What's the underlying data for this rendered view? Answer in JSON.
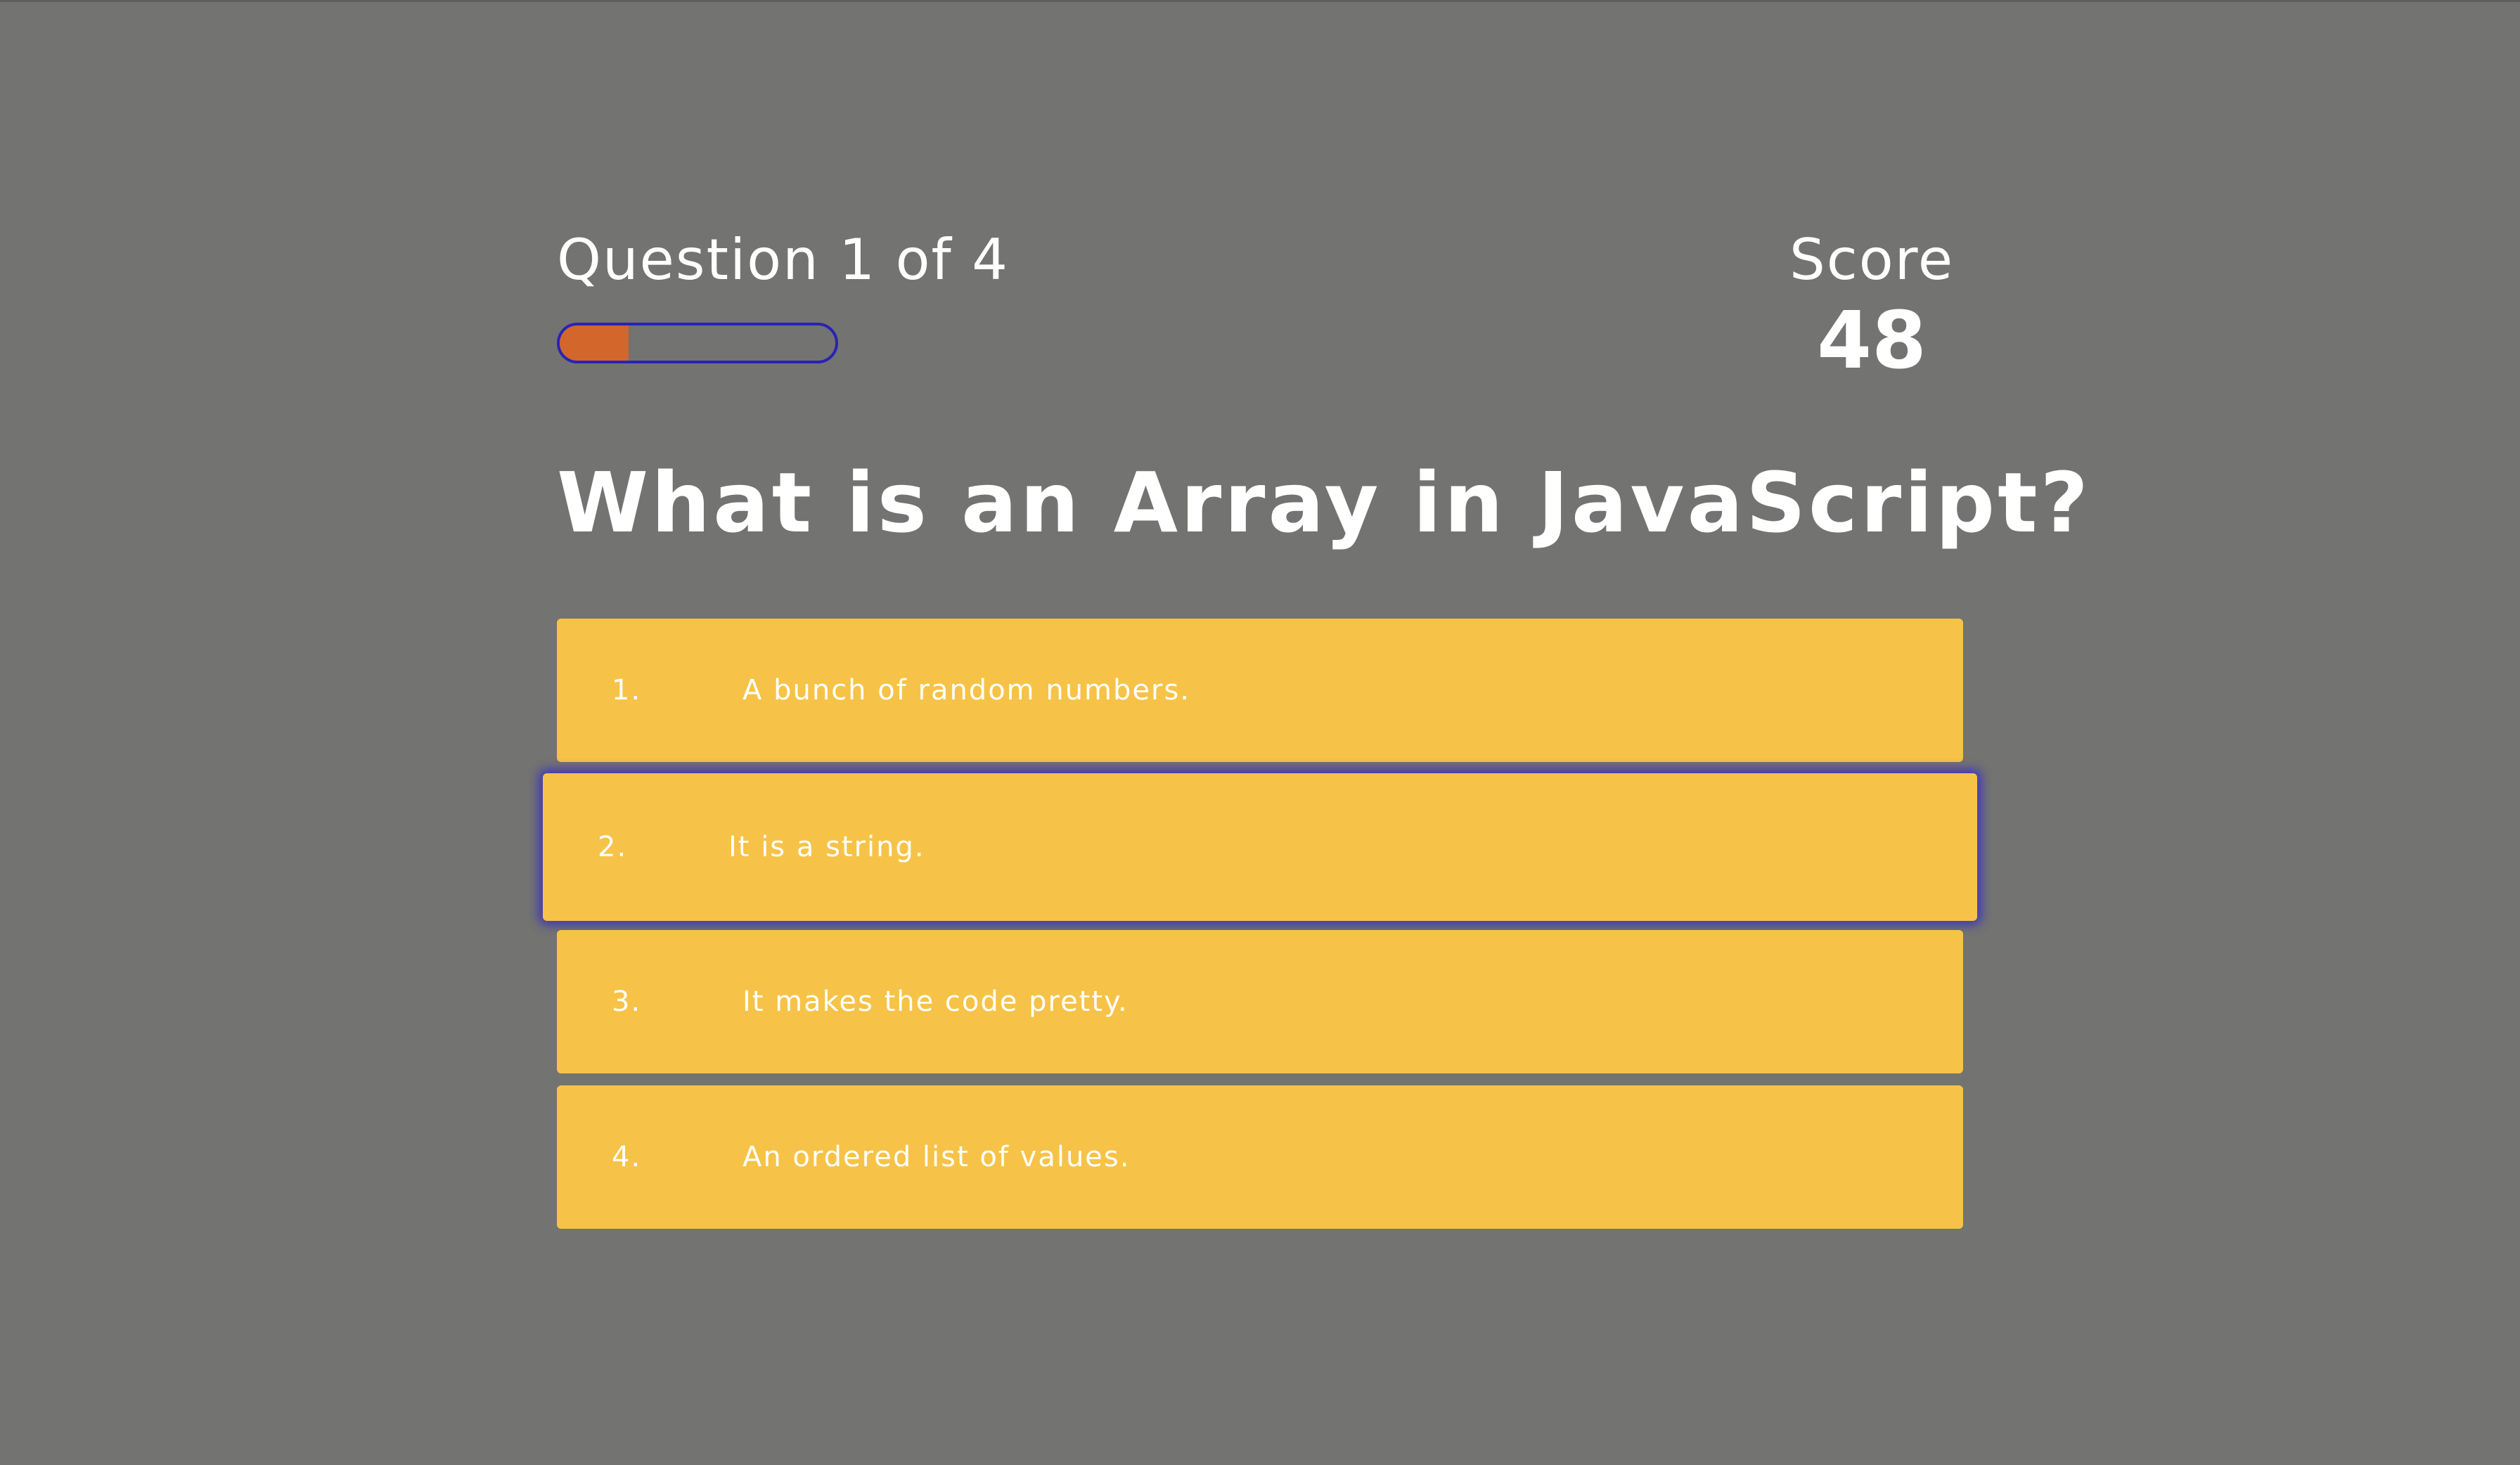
{
  "hud": {
    "progress_text": "Question 1 of 4",
    "progress_fraction": 0.25,
    "score_label": "Score",
    "score_value": "48"
  },
  "question": "What is an Array in JavaScript?",
  "choices": [
    {
      "prefix": "1.",
      "text": "A bunch of random numbers."
    },
    {
      "prefix": "2.",
      "text": "It is a string."
    },
    {
      "prefix": "3.",
      "text": "It makes the code pretty."
    },
    {
      "prefix": "4.",
      "text": "An ordered list of values."
    }
  ],
  "colors": {
    "background": "#737371",
    "choice_background": "#f6c348",
    "progress_fill": "#d2662b",
    "progress_border": "#2a22b6",
    "hover_glow": "#372dc8",
    "text": "#ffffff"
  }
}
